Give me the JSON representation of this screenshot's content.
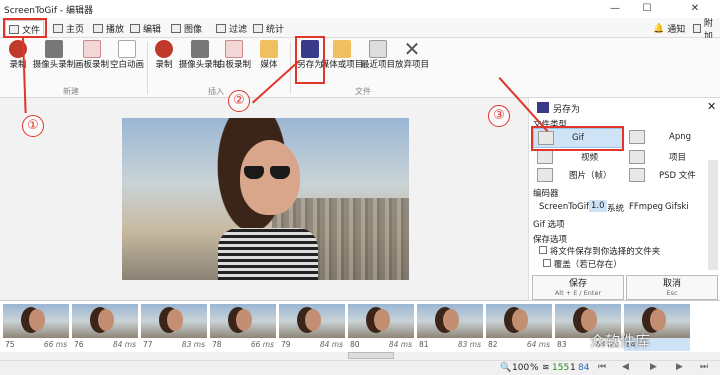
{
  "window": {
    "title": "ScreenToGif - 编辑器",
    "notify": "通知",
    "attach": "附加"
  },
  "tabs": [
    "文件",
    "主页",
    "播放",
    "编辑",
    "图像",
    "过滤",
    "统计"
  ],
  "ribbon": {
    "new_group": {
      "label": "新建",
      "buttons": [
        "录制",
        "摄像头录制",
        "画板录制",
        "空白动画"
      ]
    },
    "insert_group": {
      "label": "插入",
      "buttons": [
        "录制",
        "摄像头录制",
        "白板录制",
        "媒体"
      ]
    },
    "file_group": {
      "label": "文件",
      "buttons": [
        "另存为",
        "媒体或项目",
        "最近项目",
        "放弃项目"
      ]
    }
  },
  "panel": {
    "title": "另存为",
    "filetype_label": "文件类型",
    "types": [
      "Gif",
      "Apng",
      "视频",
      "项目",
      "图片（帧）",
      "PSD 文件"
    ],
    "encoder_label": "编码器",
    "encoders": [
      "ScreenToGif",
      "1.0",
      "系统",
      "FFmpeg",
      "Gifski"
    ],
    "gif_options": "Gif 选项",
    "save_options": "保存选项",
    "save_to_folder": "将文件保存到你选择的文件夹",
    "overwrite": "覆盖（若已存在）",
    "save_button": "保存",
    "save_hint": "Alt + E / Enter",
    "cancel_button": "取消",
    "cancel_hint": "Esc"
  },
  "frames": [
    {
      "num": "75",
      "ms": "66 ms"
    },
    {
      "num": "76",
      "ms": "84 ms"
    },
    {
      "num": "77",
      "ms": "83 ms"
    },
    {
      "num": "78",
      "ms": "66 ms"
    },
    {
      "num": "79",
      "ms": "84 ms"
    },
    {
      "num": "80",
      "ms": "84 ms"
    },
    {
      "num": "81",
      "ms": "83 ms"
    },
    {
      "num": "82",
      "ms": "64 ms"
    },
    {
      "num": "83",
      "ms": "84 ms"
    },
    {
      "num": "84",
      "ms": ""
    }
  ],
  "status": {
    "zoom": "100",
    "percent": "%",
    "total": "155",
    "selected": "1",
    "current": "84"
  },
  "annotations": [
    "①",
    "②",
    "③"
  ],
  "watermark": "众软件库",
  "colors": {
    "accent": "#e0352b",
    "selection": "#cfe3f7"
  }
}
